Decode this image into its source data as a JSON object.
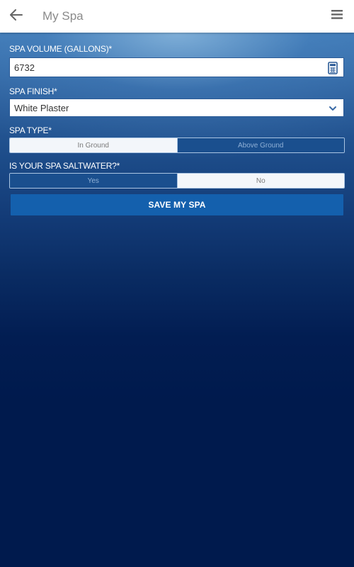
{
  "header": {
    "title": "My Spa",
    "back_icon": "arrow-left-icon",
    "menu_icon": "hamburger-menu-icon"
  },
  "form": {
    "volume": {
      "label": "SPA VOLUME (GALLONS)*",
      "value": "6732",
      "trailing_icon": "calculator-icon"
    },
    "finish": {
      "label": "SPA FINISH*",
      "selected": "White Plaster",
      "trailing_icon": "chevron-down-icon"
    },
    "type": {
      "label": "SPA TYPE*",
      "options": [
        {
          "label": "In Ground",
          "selected": true
        },
        {
          "label": "Above Ground",
          "selected": false
        }
      ]
    },
    "saltwater": {
      "label": "IS YOUR SPA SALTWATER?*",
      "options": [
        {
          "label": "Yes",
          "selected": false
        },
        {
          "label": "No",
          "selected": true
        }
      ]
    },
    "save_label": "SAVE MY SPA"
  },
  "colors": {
    "primary_button": "#1460ad",
    "background_dark": "#001a4d",
    "background_light": "#7aa9d0",
    "icon_blue": "#2a5a96"
  }
}
